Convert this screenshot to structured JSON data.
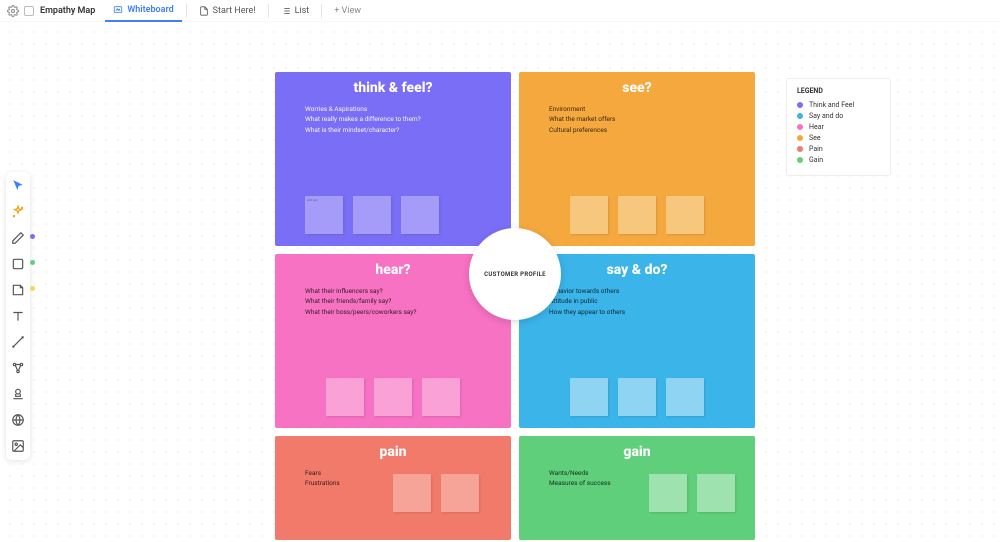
{
  "header": {
    "title": "Empathy Map",
    "tabs": [
      {
        "label": "Whiteboard",
        "active": true
      },
      {
        "label": "Start Here!",
        "active": false
      },
      {
        "label": "List",
        "active": false
      }
    ],
    "add_view": "+ View"
  },
  "center_label": "CUSTOMER PROFILE",
  "quadrants": {
    "think": {
      "title": "think & feel?",
      "lines": [
        "Worries & Aspirations",
        "What really makes a difference to them?",
        "What is their mindset/character?"
      ],
      "sticky_hint": "edit text"
    },
    "see": {
      "title": "see?",
      "lines": [
        "Environment",
        "What the market offers",
        "Cultural preferences"
      ]
    },
    "hear": {
      "title": "hear?",
      "lines": [
        "What their influencers say?",
        "What their friends/family say?",
        "What their boss/peers/coworkers say?"
      ]
    },
    "saydo": {
      "title": "say & do?",
      "lines": [
        "Behavior towards others",
        "Attitude in public",
        "How they appear to others"
      ]
    },
    "pain": {
      "title": "pain",
      "lines": [
        "Fears",
        "Frustrations"
      ]
    },
    "gain": {
      "title": "gain",
      "lines": [
        "Wants/Needs",
        "Measures of success"
      ]
    }
  },
  "legend": {
    "title": "LEGEND",
    "items": [
      {
        "label": "Think and Feel",
        "color": "#7b6ef6"
      },
      {
        "label": "Say and do",
        "color": "#3bb4ea"
      },
      {
        "label": "Hear",
        "color": "#f772c2"
      },
      {
        "label": "See",
        "color": "#f5a83e"
      },
      {
        "label": "Pain",
        "color": "#f27a6a"
      },
      {
        "label": "Gain",
        "color": "#5fcf7b"
      }
    ]
  },
  "tool_dots": {
    "pen": "#7b6ef6",
    "shape": "#5fcf7b",
    "note": "#f5d55a"
  }
}
